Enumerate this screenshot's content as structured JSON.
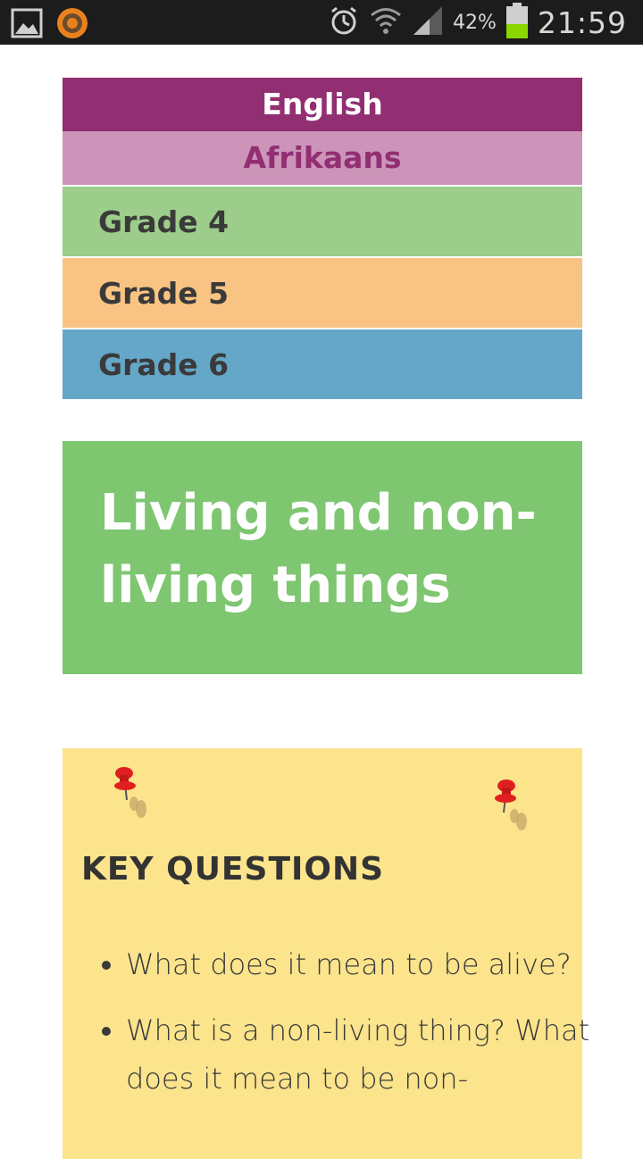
{
  "status_bar": {
    "battery": "42%",
    "time": "21:59",
    "icons": [
      "gallery-icon",
      "app-icon",
      "alarm-icon",
      "wifi-icon",
      "signal-icon",
      "battery-icon"
    ]
  },
  "nav": {
    "english": "English",
    "afrikaans": "Afrikaans",
    "grades": [
      "Grade 4",
      "Grade 5",
      "Grade 6"
    ]
  },
  "title": "Living and non-living things",
  "key_questions": {
    "heading": "KEY QUESTIONS",
    "items": [
      "What does it mean to be alive?",
      "What is a non-living thing? What does it mean to be non-"
    ]
  },
  "colors": {
    "english_bg": "#922e72",
    "afrikaans_bg": "#cb94b8",
    "grade4_bg": "#9ccd8a",
    "grade5_bg": "#f9c483",
    "grade6_bg": "#65a7c8",
    "title_bg": "#7ec670",
    "key_bg": "#fbe48c"
  }
}
